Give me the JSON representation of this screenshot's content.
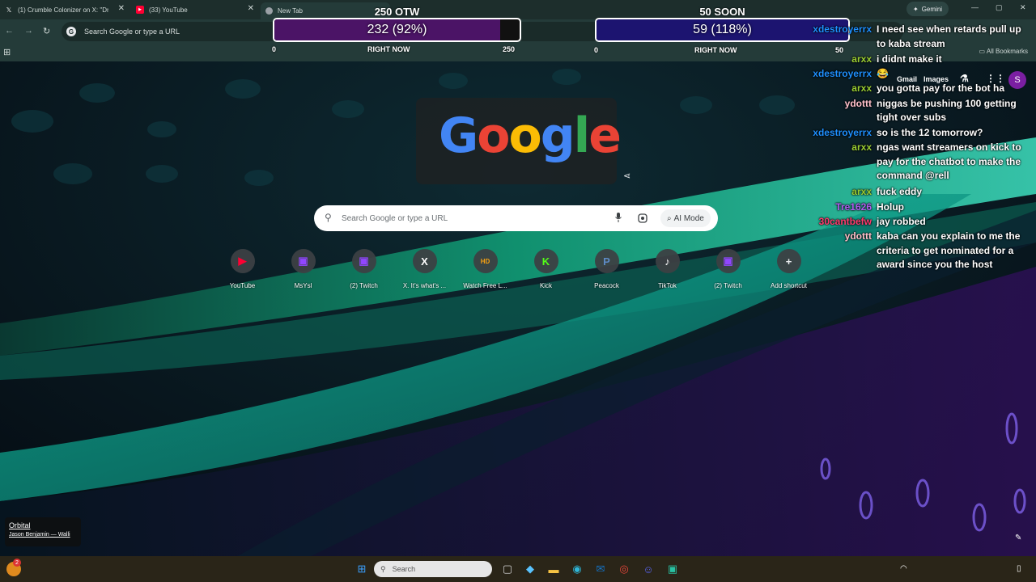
{
  "browser": {
    "tabs": [
      {
        "title": "(1) Crumble Colonizer on X: \"Dr",
        "icon": "x-logo-icon"
      },
      {
        "title": "(33) YouTube",
        "icon": "youtube-icon"
      },
      {
        "title": "New Tab",
        "icon": "chrome-icon"
      }
    ],
    "gemini_label": "Gemini",
    "omnibox_placeholder": "Search Google or type a URL",
    "all_bookmarks_label": "All Bookmarks"
  },
  "overlays": {
    "goal_left": {
      "title": "250 OTW",
      "value_text": "232 (92%)",
      "progress": 0.92,
      "min": "0",
      "max": "250",
      "sublabel": "RIGHT NOW",
      "fill_color": "#4b1466"
    },
    "goal_right": {
      "title": "50 SOON",
      "value_text": "59 (118%)",
      "progress": 1.0,
      "min": "0",
      "max": "50",
      "sublabel": "RIGHT NOW",
      "fill_color": "#1c1470"
    }
  },
  "ntp": {
    "doodle_text": "Google",
    "header_links": {
      "gmail": "Gmail",
      "images": "Images"
    },
    "avatar_letter": "S",
    "search_placeholder": "Search Google or type a URL",
    "ai_mode_label": "AI Mode",
    "shortcuts": [
      {
        "label": "YouTube",
        "icon": "youtube-icon",
        "glyph": "▶",
        "color": "#ff0033"
      },
      {
        "label": "MsYsl",
        "icon": "twitch-icon",
        "glyph": "▣",
        "color": "#9146ff"
      },
      {
        "label": "(2) Twitch",
        "icon": "twitch-icon",
        "glyph": "▣",
        "color": "#9146ff"
      },
      {
        "label": "X. It's what's ...",
        "icon": "x-logo-icon",
        "glyph": "X",
        "color": "#ffffff"
      },
      {
        "label": "Watch Free L...",
        "icon": "hd-icon",
        "glyph": "HD",
        "color": "#f4a012"
      },
      {
        "label": "Kick",
        "icon": "kick-icon",
        "glyph": "K",
        "color": "#53fc18"
      },
      {
        "label": "Peacock",
        "icon": "peacock-icon",
        "glyph": "P",
        "color": "#5d8ac5"
      },
      {
        "label": "TikTok",
        "icon": "tiktok-icon",
        "glyph": "♪",
        "color": "#ffffff"
      },
      {
        "label": "(2) Twitch",
        "icon": "twitch-icon",
        "glyph": "▣",
        "color": "#9146ff"
      },
      {
        "label": "Add shortcut",
        "icon": "plus-icon",
        "glyph": "+",
        "color": "#e8eaed"
      }
    ]
  },
  "chat": [
    {
      "user": "xdestroyerrx",
      "color": "#1e90ff",
      "message": "I need see when retards pull up to kaba stream",
      "lines": 2
    },
    {
      "user": "arxx",
      "color": "#9acd32",
      "message": "i didnt make it",
      "lines": 1
    },
    {
      "user": "xdestroyerrx",
      "color": "#1e90ff",
      "message": "😂",
      "lines": 1
    },
    {
      "user": "arxx",
      "color": "#9acd32",
      "message": "you gotta pay for the bot ha",
      "lines": 1
    },
    {
      "user": "ydottt",
      "color": "#ffc0cb",
      "message": "niggas be pushing 100 getting tight over subs",
      "lines": 2
    },
    {
      "user": "xdestroyerrx",
      "color": "#1e90ff",
      "message": "so is the 12 tomorrow?",
      "lines": 1
    },
    {
      "user": "arxx",
      "color": "#9acd32",
      "message": "ngas want streamers on kick to pay for the chatbot to make the command @rell",
      "lines": 3
    },
    {
      "user": "arxx",
      "color": "#9acd32",
      "message": "fuck eddy",
      "lines": 1
    },
    {
      "user": "Tre1626",
      "color": "#b05cf0",
      "message": "Holup",
      "lines": 1
    },
    {
      "user": "30cantbefw",
      "color": "#ff3a6e",
      "message": "jay robbed",
      "lines": 1
    },
    {
      "user": "ydottt",
      "color": "#ffc0cb",
      "message": "kaba can you explain to me the criteria to get nominated for a award since you the host",
      "lines": 3
    }
  ],
  "now_playing": {
    "title": "Orbital",
    "artist": "Jason Benjamin — Walli"
  },
  "taskbar": {
    "search_placeholder": "Search",
    "badge_count": "2",
    "pinned": [
      {
        "icon": "windows-start-icon",
        "glyph": "⊞",
        "color": "#3aa0ff"
      },
      {
        "icon": "task-view-icon",
        "glyph": "▢",
        "color": "#cccccc"
      },
      {
        "icon": "copilot-icon",
        "glyph": "◆",
        "color": "#59c3ff"
      },
      {
        "icon": "file-explorer-icon",
        "glyph": "▬",
        "color": "#f6c344"
      },
      {
        "icon": "edge-icon",
        "glyph": "◉",
        "color": "#2fb6d8"
      },
      {
        "icon": "outlook-icon",
        "glyph": "✉",
        "color": "#1473c6"
      },
      {
        "icon": "chrome-icon",
        "glyph": "◎",
        "color": "#e9463b"
      },
      {
        "icon": "discord-icon",
        "glyph": "☺",
        "color": "#5865f2"
      },
      {
        "icon": "app-icon",
        "glyph": "▣",
        "color": "#28c2a3"
      }
    ]
  }
}
